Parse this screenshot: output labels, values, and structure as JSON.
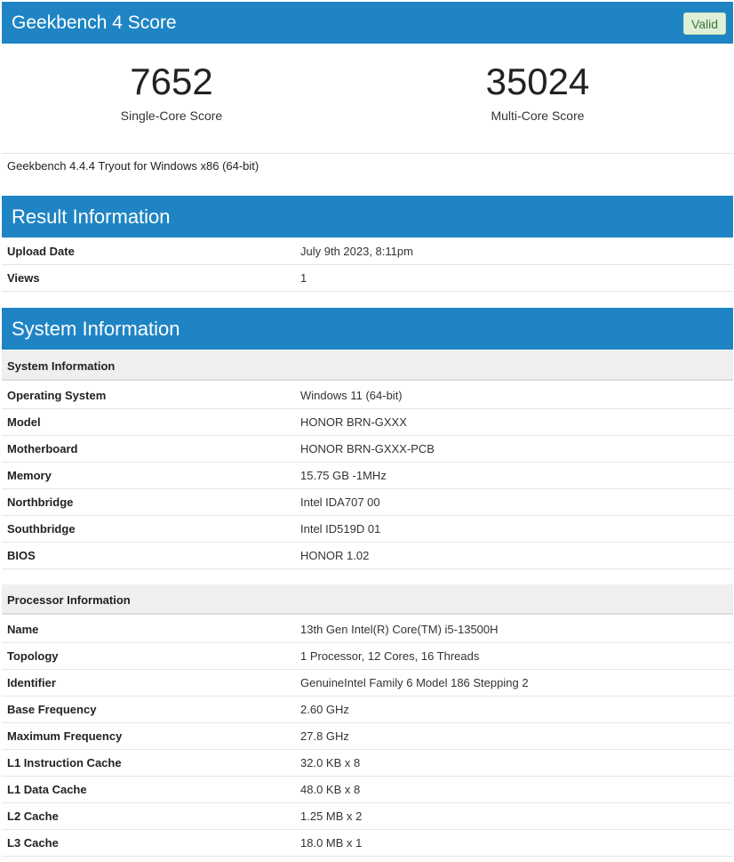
{
  "header": {
    "title": "Geekbench 4 Score",
    "badge": "Valid"
  },
  "scores": {
    "single_value": "7652",
    "single_label": "Single-Core Score",
    "multi_value": "35024",
    "multi_label": "Multi-Core Score"
  },
  "version_line": "Geekbench 4.4.4 Tryout for Windows x86 (64-bit)",
  "result": {
    "title": "Result Information",
    "rows": [
      {
        "k": "Upload Date",
        "v": "July 9th 2023, 8:11pm"
      },
      {
        "k": "Views",
        "v": "1"
      }
    ]
  },
  "system": {
    "title": "System Information",
    "sys_sub": "System Information",
    "sys_rows": [
      {
        "k": "Operating System",
        "v": "Windows 11 (64-bit)"
      },
      {
        "k": "Model",
        "v": "HONOR BRN-GXXX"
      },
      {
        "k": "Motherboard",
        "v": "HONOR BRN-GXXX-PCB"
      },
      {
        "k": "Memory",
        "v": "15.75 GB -1MHz"
      },
      {
        "k": "Northbridge",
        "v": "Intel IDA707 00"
      },
      {
        "k": "Southbridge",
        "v": "Intel ID519D 01"
      },
      {
        "k": "BIOS",
        "v": "HONOR 1.02"
      }
    ],
    "proc_sub": "Processor Information",
    "proc_rows": [
      {
        "k": "Name",
        "v": "13th Gen Intel(R) Core(TM) i5-13500H"
      },
      {
        "k": "Topology",
        "v": "1 Processor, 12 Cores, 16 Threads"
      },
      {
        "k": "Identifier",
        "v": "GenuineIntel Family 6 Model 186 Stepping 2"
      },
      {
        "k": "Base Frequency",
        "v": "2.60 GHz"
      },
      {
        "k": "Maximum Frequency",
        "v": "27.8 GHz"
      },
      {
        "k": "L1 Instruction Cache",
        "v": "32.0 KB x 8"
      },
      {
        "k": "L1 Data Cache",
        "v": "48.0 KB x 8"
      },
      {
        "k": "L2 Cache",
        "v": "1.25 MB x 2"
      },
      {
        "k": "L3 Cache",
        "v": "18.0 MB x 1"
      }
    ]
  },
  "colors": {
    "header_blue": "#1f84c4",
    "valid_bg": "#dff0d8",
    "valid_text": "#3c763d"
  }
}
